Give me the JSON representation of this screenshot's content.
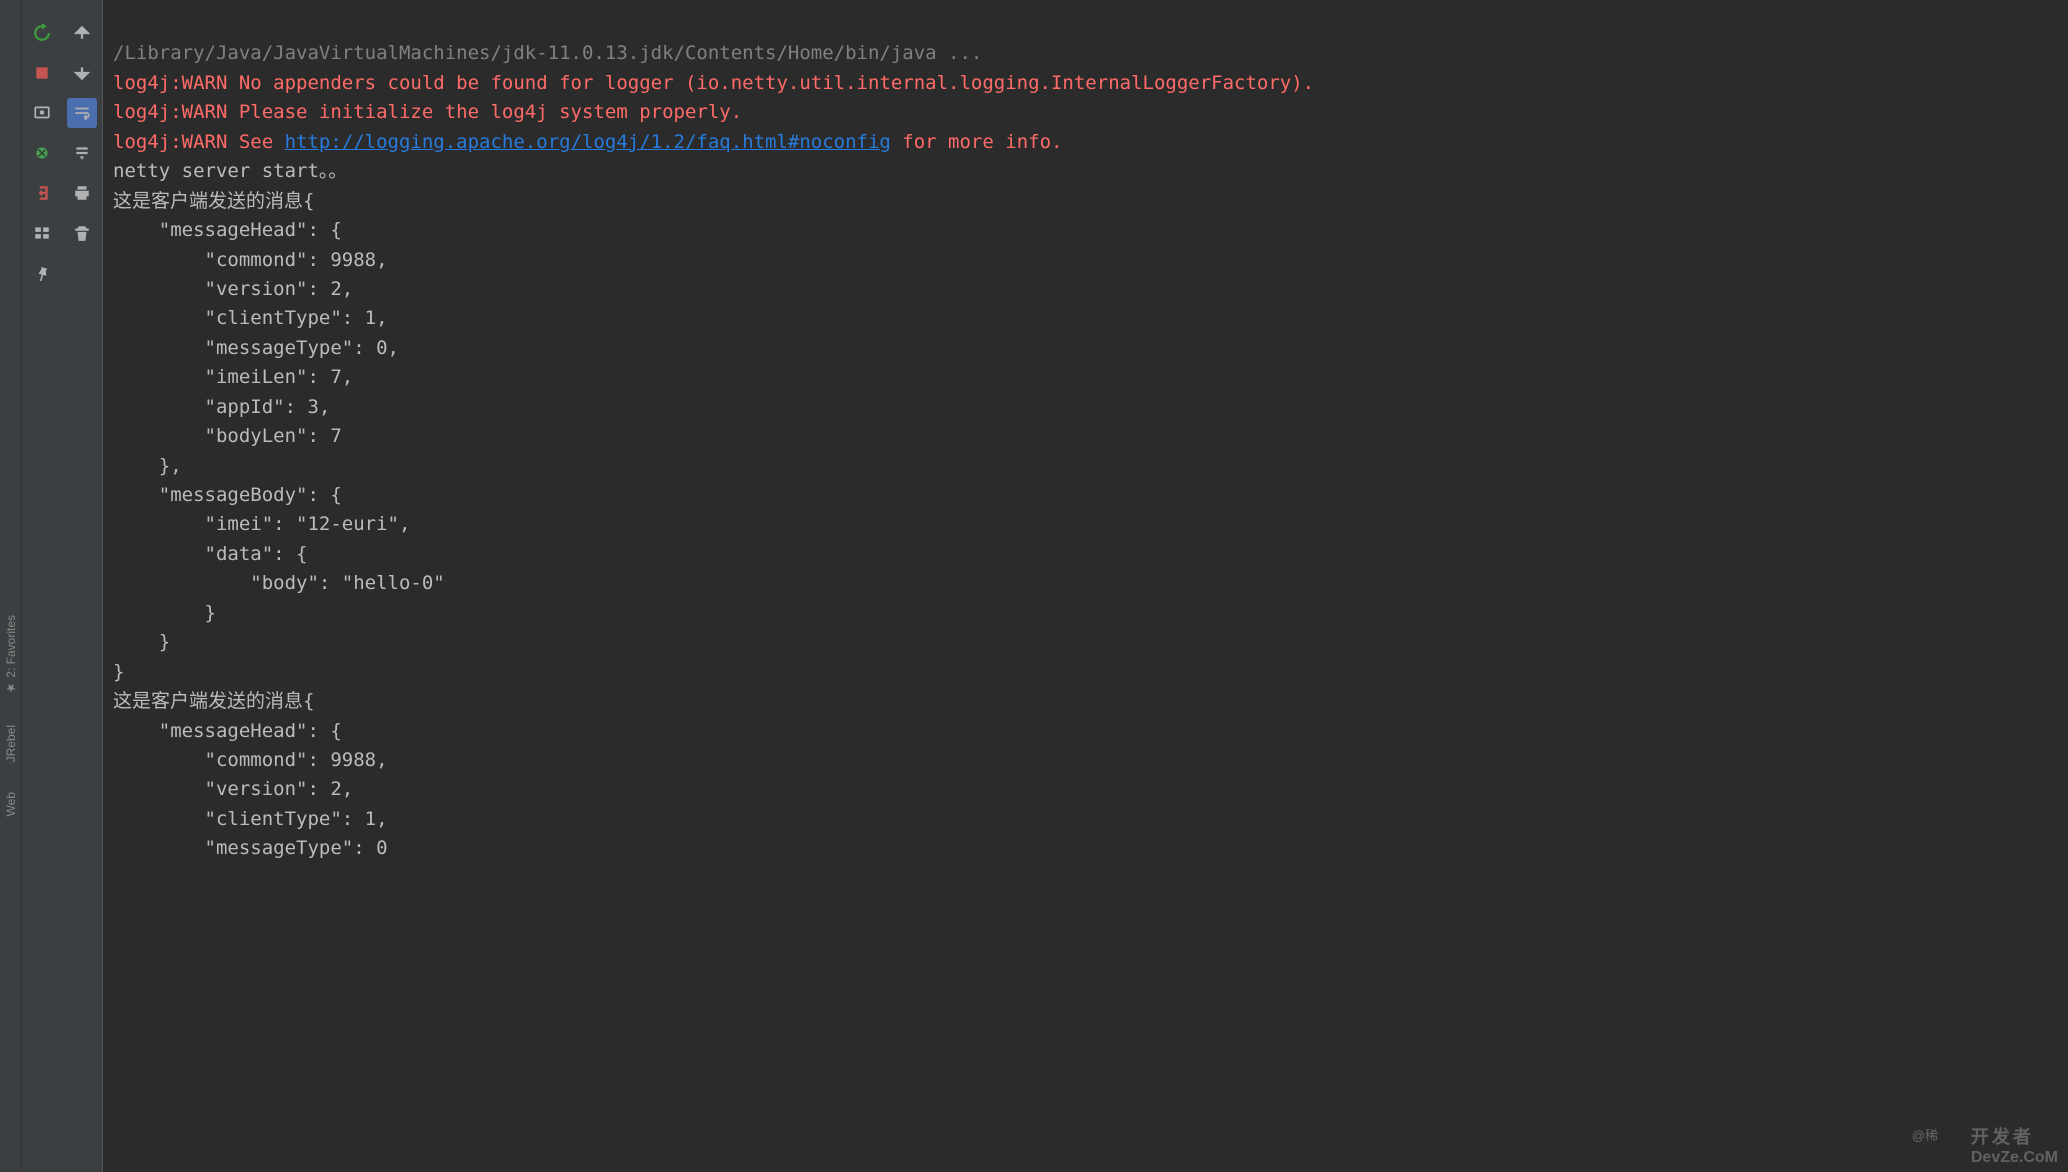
{
  "sidebar": {
    "items": [
      {
        "label": "★ 2: Favorites"
      },
      {
        "label": "JRebel"
      },
      {
        "label": "Web"
      }
    ]
  },
  "toolbar_left": {
    "rerun": "Rerun",
    "stop": "Stop",
    "dump": "Dump",
    "debug": "Debug",
    "exit": "Exit",
    "layout": "Layout",
    "pin": "Pin"
  },
  "toolbar_right": {
    "up": "Up",
    "down": "Down",
    "wrap": "Soft-Wrap",
    "scroll": "Scroll to End",
    "print": "Print",
    "clear": "Clear All"
  },
  "console": {
    "java_path": "/Library/Java/JavaVirtualMachines/jdk-11.0.13.jdk/Contents/Home/bin/java ...",
    "warn1": "log4j:WARN No appenders could be found for logger (io.netty.util.internal.logging.InternalLoggerFactory).",
    "warn2": "log4j:WARN Please initialize the log4j system properly.",
    "warn3_prefix": "log4j:WARN See ",
    "warn3_link": "http://logging.apache.org/log4j/1.2/faq.html#noconfig",
    "warn3_suffix": " for more info.",
    "server_start": "netty server start。。",
    "msg_prefix": "这是客户端发送的消息{",
    "json1": {
      "l1": "    \"messageHead\": {",
      "l2": "        \"commond\": 9988,",
      "l3": "        \"version\": 2,",
      "l4": "        \"clientType\": 1,",
      "l5": "        \"messageType\": 0,",
      "l6": "        \"imeiLen\": 7,",
      "l7": "        \"appId\": 3,",
      "l8": "        \"bodyLen\": 7",
      "l9": "    },",
      "l10": "    \"messageBody\": {",
      "l11": "        \"imei\": \"12-euri\",",
      "l12": "        \"data\": {",
      "l13": "            \"body\": \"hello-0\"",
      "l14": "        }",
      "l15": "    }",
      "l16": "}"
    },
    "json2": {
      "l1": "    \"messageHead\": {",
      "l2": "        \"commond\": 9988,",
      "l3": "        \"version\": 2,",
      "l4": "        \"clientType\": 1,",
      "l5": "        \"messageType\": 0"
    }
  },
  "watermark": {
    "user": "@稀",
    "line1": "开发者",
    "line2": "DevZe.CoM"
  }
}
